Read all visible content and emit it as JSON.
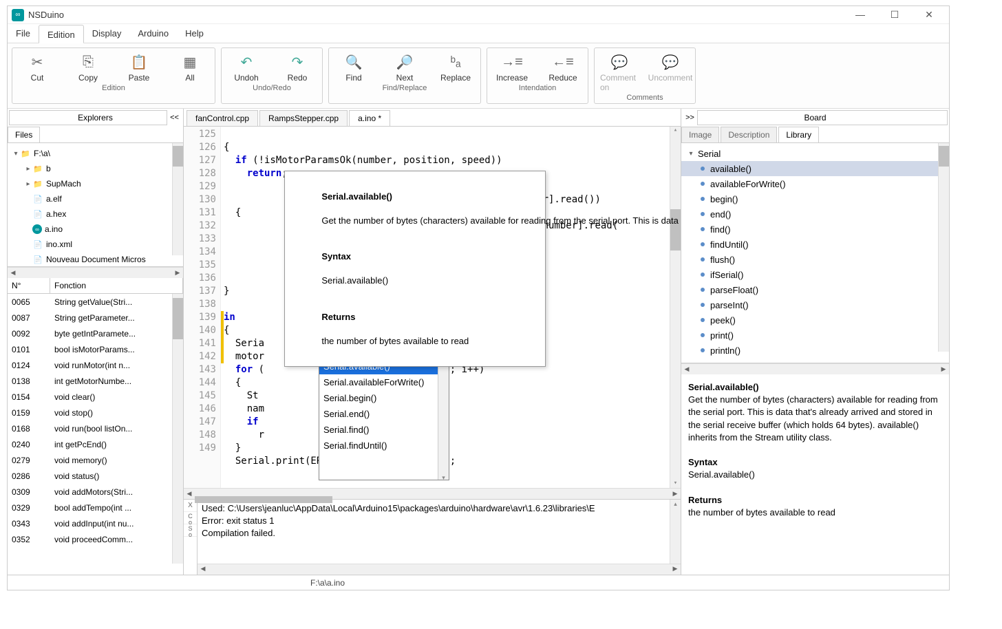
{
  "title": "NSDuino",
  "menu": [
    "File",
    "Edition",
    "Display",
    "Arduino",
    "Help"
  ],
  "menu_active": 1,
  "ribbon_groups": [
    {
      "label": "Edition",
      "buttons": [
        {
          "name": "cut-button",
          "icon": "✂",
          "label": "Cut"
        },
        {
          "name": "copy-button",
          "icon": "⎘",
          "label": "Copy"
        },
        {
          "name": "paste-button",
          "icon": "📋",
          "label": "Paste"
        },
        {
          "name": "all-button",
          "icon": "▦",
          "label": "All"
        }
      ]
    },
    {
      "label": "Undo/Redo",
      "buttons": [
        {
          "name": "undo-button",
          "icon": "↶",
          "label": "Undoh",
          "color": "#4a9"
        },
        {
          "name": "redo-button",
          "icon": "↷",
          "label": "Redo",
          "color": "#4a9"
        }
      ]
    },
    {
      "label": "Find/Replace",
      "buttons": [
        {
          "name": "find-button",
          "icon": "🔍",
          "label": "Find"
        },
        {
          "name": "next-button",
          "icon": "🔎",
          "label": "Next"
        },
        {
          "name": "replace-button",
          "icon": "ᵇₐ",
          "label": "Replace"
        }
      ]
    },
    {
      "label": "Intendation",
      "buttons": [
        {
          "name": "increase-indent-button",
          "icon": "→≡",
          "label": "Increase"
        },
        {
          "name": "reduce-indent-button",
          "icon": "←≡",
          "label": "Reduce"
        }
      ]
    },
    {
      "label": "Comments",
      "buttons": [
        {
          "name": "comment-button",
          "icon": "💬",
          "label": "Comment on",
          "disabled": true
        },
        {
          "name": "uncomment-button",
          "icon": "💬",
          "label": "Uncomment",
          "disabled": true
        }
      ]
    }
  ],
  "left_header": "Explorers",
  "left_collapse": "<<",
  "files_tab": "Files",
  "tree_root": "F:\\a\\",
  "tree_items": [
    {
      "indent": 1,
      "toggle": "▸",
      "type": "folder",
      "name": "b"
    },
    {
      "indent": 1,
      "toggle": "▸",
      "type": "folder",
      "name": "SupMach"
    },
    {
      "indent": 1,
      "toggle": "",
      "type": "file",
      "name": "a.elf"
    },
    {
      "indent": 1,
      "toggle": "",
      "type": "file",
      "name": "a.hex"
    },
    {
      "indent": 1,
      "toggle": "",
      "type": "ino",
      "name": "a.ino"
    },
    {
      "indent": 1,
      "toggle": "",
      "type": "file",
      "name": "ino.xml"
    },
    {
      "indent": 1,
      "toggle": "",
      "type": "file",
      "name": "Nouveau Document Micros"
    }
  ],
  "func_headers": {
    "num": "N°",
    "func": "Fonction"
  },
  "functions": [
    {
      "n": "0065",
      "f": "String getValue(Stri..."
    },
    {
      "n": "0087",
      "f": "String getParameter..."
    },
    {
      "n": "0092",
      "f": "byte getIntParamete..."
    },
    {
      "n": "0101",
      "f": "bool isMotorParams..."
    },
    {
      "n": "0124",
      "f": "void runMotor(int n..."
    },
    {
      "n": "0138",
      "f": "int getMotorNumbe..."
    },
    {
      "n": "0154",
      "f": "void clear()"
    },
    {
      "n": "0159",
      "f": "void stop()"
    },
    {
      "n": "0168",
      "f": "void run(bool listOn..."
    },
    {
      "n": "0240",
      "f": "int getPcEnd()"
    },
    {
      "n": "0279",
      "f": "void memory()"
    },
    {
      "n": "0286",
      "f": "void status()"
    },
    {
      "n": "0309",
      "f": "void addMotors(Stri..."
    },
    {
      "n": "0329",
      "f": "bool addTempo(int ..."
    },
    {
      "n": "0343",
      "f": "void addInput(int nu..."
    },
    {
      "n": "0352",
      "f": "void proceedComm..."
    }
  ],
  "editor_tabs": [
    {
      "label": "fanControl.cpp",
      "active": false
    },
    {
      "label": "RampsStepper.cpp",
      "active": false
    },
    {
      "label": "a.ino *",
      "active": true
    }
  ],
  "line_start": 125,
  "line_count": 25,
  "tooltip": {
    "title": "Serial.available()",
    "desc": "Get the number of bytes (characters) available for reading from the serial port. This is data that's already arrived and stored in the serial receive buffer (which holds 64 bytes). available() inherits from the Stream utility class.",
    "syntax_h": "Syntax",
    "syntax": "Serial.available()",
    "returns_h": "Returns",
    "returns": "the number of bytes available to read"
  },
  "autocomplete": [
    "Serial.available()",
    "Serial.availableForWrite()",
    "Serial.begin()",
    "Serial.end()",
    "Serial.find()",
    "Serial.findUntil()"
  ],
  "autocomplete_sel": 0,
  "output": {
    "line1": "Used: C:\\Users\\jeanluc\\AppData\\Local\\Arduino15\\packages\\arduino\\hardware\\avr\\1.6.23\\libraries\\E",
    "line2": "Error: exit status 1",
    "line3": "Compilation failed."
  },
  "right_header": "Board",
  "right_expand": ">>",
  "right_tabs": [
    "Image",
    "Description",
    "Library"
  ],
  "right_tab_active": 2,
  "lib_root": "Serial",
  "lib_items": [
    "available()",
    "availableForWrite()",
    "begin()",
    "end()",
    "find()",
    "findUntil()",
    "flush()",
    "ifSerial()",
    "parseFloat()",
    "parseInt()",
    "peek()",
    "print()",
    "println()"
  ],
  "lib_sel": 0,
  "lib_desc": {
    "title": "Serial.available()",
    "desc": "Get the number of bytes (characters) available for reading from the serial port. This is data that's already arrived and stored in the serial receive buffer (which holds 64 bytes). available() inherits from the Stream utility class.",
    "syntax_h": "Syntax",
    "syntax": "Serial.available()",
    "returns_h": "Returns",
    "returns": "the number of bytes available to read"
  },
  "statusbar": "F:\\a\\a.ino"
}
